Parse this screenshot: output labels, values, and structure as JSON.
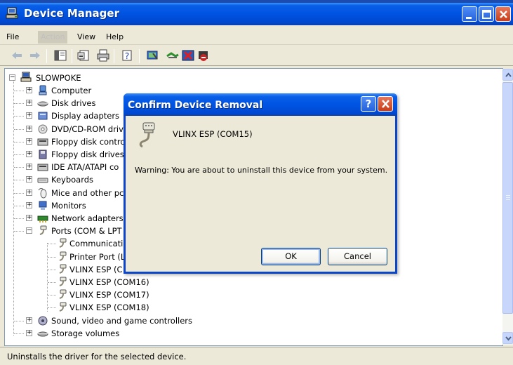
{
  "window": {
    "title": "Device Manager",
    "title_bar_color": "#0054e3"
  },
  "menu": {
    "file": "File",
    "action": "Action",
    "view": "View",
    "help": "Help"
  },
  "toolbar": {
    "icons": [
      "back-arrow-icon",
      "forward-arrow-icon",
      "console-tree-icon",
      "properties-icon",
      "print-icon",
      "help-icon",
      "scan-hardware-icon",
      "update-driver-icon",
      "uninstall-icon",
      "disable-icon"
    ]
  },
  "tree": {
    "root": "SLOWPOKE",
    "categories": [
      {
        "label": "Computer",
        "icon": "computer-icon",
        "expanded": false
      },
      {
        "label": "Disk drives",
        "icon": "disk-drive-icon",
        "expanded": false
      },
      {
        "label": "Display adapters",
        "icon": "display-adapter-icon",
        "expanded": false
      },
      {
        "label": "DVD/CD-ROM driv",
        "icon": "dvd-icon",
        "expanded": false
      },
      {
        "label": "Floppy disk contro",
        "icon": "floppy-controller-icon",
        "expanded": false
      },
      {
        "label": "Floppy disk drives",
        "icon": "floppy-drive-icon",
        "expanded": false
      },
      {
        "label": "IDE ATA/ATAPI co",
        "icon": "ide-icon",
        "expanded": false
      },
      {
        "label": "Keyboards",
        "icon": "keyboard-icon",
        "expanded": false
      },
      {
        "label": "Mice and other pc",
        "icon": "mouse-icon",
        "expanded": false
      },
      {
        "label": "Monitors",
        "icon": "monitor-icon",
        "expanded": false
      },
      {
        "label": "Network adapters",
        "icon": "network-adapter-icon",
        "expanded": false
      },
      {
        "label": "Ports (COM & LPT",
        "icon": "port-icon",
        "expanded": true
      }
    ],
    "ports_children": [
      "Communicatio",
      "Printer Port (L",
      "VLINX ESP (C",
      "VLINX ESP (COM16)",
      "VLINX ESP (COM17)",
      "VLINX ESP (COM18)"
    ],
    "after_categories": [
      {
        "label": "Sound, video and game controllers",
        "icon": "sound-icon"
      },
      {
        "label": "Storage volumes",
        "icon": "storage-icon"
      }
    ]
  },
  "status": {
    "text": "Uninstalls the driver for the selected device."
  },
  "dialog": {
    "title": "Confirm Device Removal",
    "help_glyph": "?",
    "device_name": "VLINX ESP (COM15)",
    "warning": "Warning: You are about to uninstall this device from your system.",
    "ok_label": "OK",
    "cancel_label": "Cancel"
  }
}
